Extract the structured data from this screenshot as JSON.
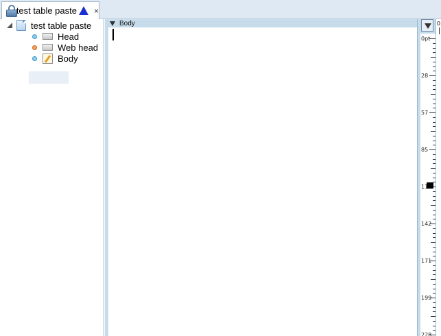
{
  "tab": {
    "title": "test table paste",
    "close": "×"
  },
  "tree": {
    "root": "test table paste",
    "items": [
      {
        "label": "Head",
        "bullet": "blue"
      },
      {
        "label": "Web head",
        "bullet": "orange"
      },
      {
        "label": "Body",
        "bullet": "blue",
        "selected": true
      }
    ]
  },
  "editor": {
    "section_label": "Body"
  },
  "ruler": {
    "labels": [
      "0pt",
      "28",
      "57",
      "85",
      "114",
      "142",
      "171",
      "199",
      "228"
    ]
  },
  "farstrip": {
    "label": "0"
  }
}
